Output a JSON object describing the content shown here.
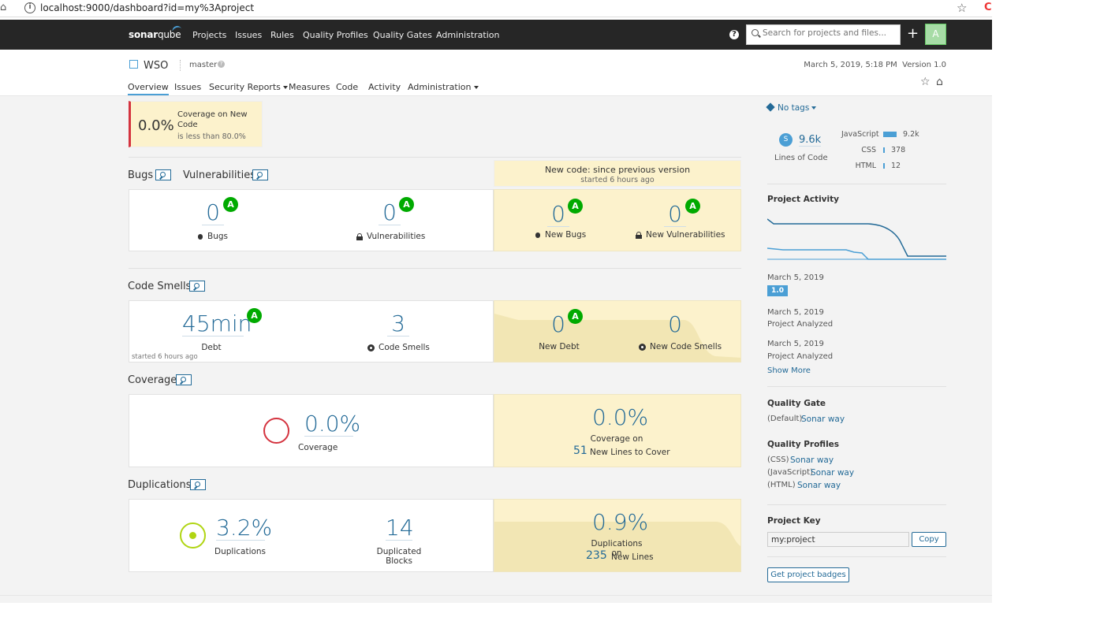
{
  "browser": {
    "url": "localhost:9000/dashboard?id=my%3Aproject"
  },
  "topnav": {
    "logo_bold": "sonar",
    "logo_light": "qube",
    "links": [
      "Projects",
      "Issues",
      "Rules",
      "Quality Profiles",
      "Quality Gates",
      "Administration"
    ],
    "help": "?",
    "search_placeholder": "Search for projects and files...",
    "plus": "+",
    "avatar": "A"
  },
  "project": {
    "name": "WSO",
    "branch": "master",
    "analysis_date": "March 5, 2019, 5:18 PM",
    "version": "Version 1.0",
    "tabs": [
      "Overview",
      "Issues",
      "Security Reports",
      "Measures",
      "Code",
      "Activity",
      "Administration"
    ]
  },
  "quality_gate_condition": {
    "value": "0.0%",
    "title": "Coverage on New Code",
    "condition": "is less than 80.0%"
  },
  "new_code": {
    "title": "New code: since previous version",
    "started": "started 6 hours ago"
  },
  "bugs_vulns": {
    "heading_bugs": "Bugs",
    "heading_vulns": "Vulnerabilities",
    "bugs": "0",
    "bugs_rating": "A",
    "bugs_label": "Bugs",
    "vulns": "0",
    "vulns_rating": "A",
    "vulns_label": "Vulnerabilities",
    "new_bugs": "0",
    "new_bugs_rating": "A",
    "new_bugs_label": "New Bugs",
    "new_vulns": "0",
    "new_vulns_rating": "A",
    "new_vulns_label": "New Vulnerabilities"
  },
  "code_smells": {
    "heading": "Code Smells",
    "debt": "45min",
    "debt_rating": "A",
    "debt_label": "Debt",
    "smells": "3",
    "smells_label": "Code Smells",
    "started": "started 6 hours ago",
    "new_debt": "0",
    "new_debt_rating": "A",
    "new_debt_label": "New Debt",
    "new_smells": "0",
    "new_smells_label": "New Code Smells"
  },
  "coverage": {
    "heading": "Coverage",
    "value": "0.0%",
    "label": "Coverage",
    "new_value": "0.0%",
    "new_label": "Coverage on",
    "new_lines": "51",
    "new_lines_label": "New Lines to Cover"
  },
  "duplications": {
    "heading": "Duplications",
    "value": "3.2%",
    "label": "Duplications",
    "blocks": "14",
    "blocks_label": "Duplicated Blocks",
    "new_value": "0.9%",
    "new_label": "Duplications on",
    "new_lines": "235",
    "new_lines_label": "New Lines"
  },
  "sidebar": {
    "tags": "No tags",
    "size_badge": "S",
    "loc": "9.6k",
    "loc_label": "Lines of Code",
    "languages": [
      {
        "name": "JavaScript",
        "value": "9.2k",
        "share": 0.95
      },
      {
        "name": "CSS",
        "value": "378",
        "share": 0.04
      },
      {
        "name": "HTML",
        "value": "12",
        "share": 0.01
      }
    ],
    "activity_title": "Project Activity",
    "events": [
      {
        "date": "March 5, 2019",
        "version": "1.0"
      },
      {
        "date": "March 5, 2019",
        "text": "Project Analyzed"
      },
      {
        "date": "March 5, 2019",
        "text": "Project Analyzed"
      }
    ],
    "show_more": "Show More",
    "gate_title": "Quality Gate",
    "gate_default": "(Default)",
    "gate_name": "Sonar way",
    "profiles_title": "Quality Profiles",
    "profiles": [
      {
        "lang": "(CSS)",
        "name": "Sonar way"
      },
      {
        "lang": "(JavaScript)",
        "name": "Sonar way"
      },
      {
        "lang": "(HTML)",
        "name": "Sonar way"
      }
    ],
    "key_title": "Project Key",
    "key_value": "my:project",
    "copy": "Copy",
    "badges": "Get project badges"
  },
  "colors": {
    "accent": "#4b9fd5",
    "link": "#236a97",
    "leak": "#fcf2cc",
    "rating_a": "#00aa00",
    "error": "#d4333f",
    "nav": "#262626"
  }
}
